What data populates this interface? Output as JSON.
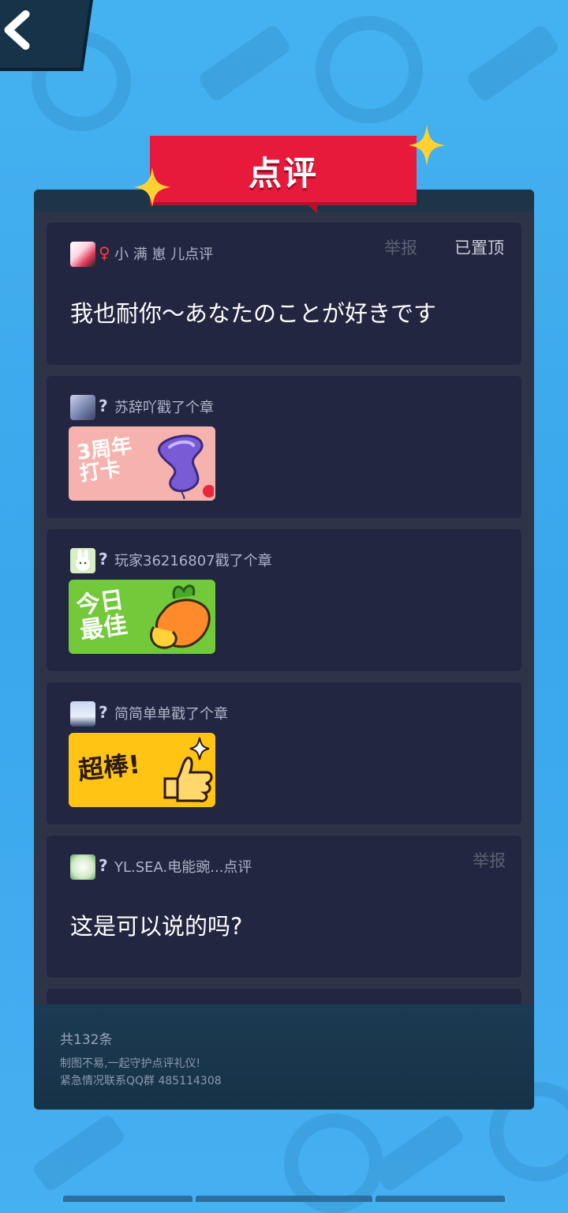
{
  "header": {
    "title": "点评"
  },
  "reviews": [
    {
      "gender_symbol": "♀",
      "gender_color": "#ff3b3b",
      "user_text": "小 满 崽 儿点评",
      "report_label": "举报",
      "pinned_label": "已置顶",
      "comment": "我也耐你〜あなたのことが好きです"
    },
    {
      "gender_symbol": "?",
      "gender_color": "#c9d2e6",
      "user_text": "苏辞吖戳了个章",
      "sticker_text": "3周年 打卡",
      "sticker_bg": "#f6b3ae"
    },
    {
      "gender_symbol": "?",
      "gender_color": "#c9d2e6",
      "user_text": "玩家36216807戳了个章",
      "sticker_text": "今日 最佳",
      "sticker_bg": "#72c93a"
    },
    {
      "gender_symbol": "?",
      "gender_color": "#c9d2e6",
      "user_text": "简简单单戳了个章",
      "sticker_text": "超棒!",
      "sticker_bg": "#ffc414"
    },
    {
      "gender_symbol": "?",
      "gender_color": "#c9d2e6",
      "user_text": "YL.SEA.电能豌...点评",
      "report_label": "举报",
      "comment": "这是可以说的吗?"
    }
  ],
  "footer": {
    "count": "共132条",
    "notice_line1": "制图不易,一起守护点评礼仪!",
    "notice_line2": "紧急情况联系QQ群 485114308"
  },
  "icons": {
    "back": "chevron-left-icon",
    "star": "sparkle-star-icon"
  }
}
